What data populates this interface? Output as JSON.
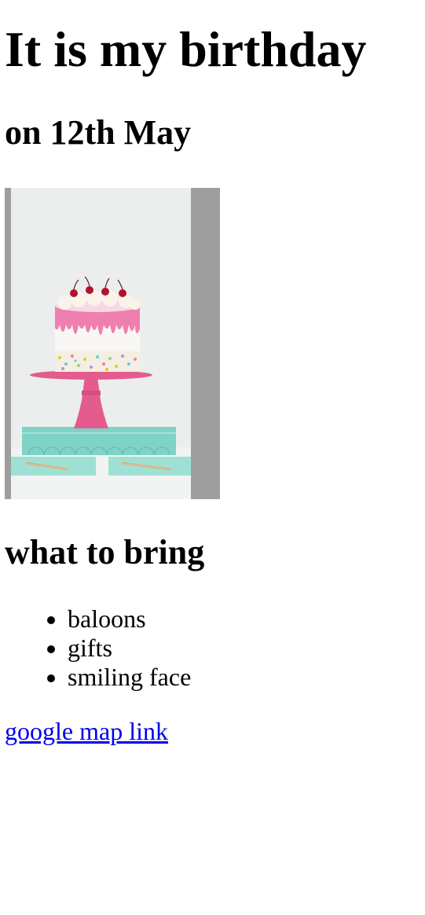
{
  "page": {
    "title": "It is my birthday",
    "subtitle": "on 12th May",
    "section_heading": "what to bring",
    "bring_items": [
      "baloons",
      "gifts",
      "smiling face"
    ],
    "map_link_text": "google map link"
  },
  "image": {
    "alt": "birthday cake on a pink cake stand",
    "colors": {
      "background_gray": "#9e9e9e",
      "wall": "#eceeee",
      "frosting": "#f8d8e4",
      "drip": "#ef7fae",
      "stand": "#e35c8d",
      "tray": "#7fd3c6",
      "cherry": "#b3122d"
    }
  },
  "theme": {
    "link_color": "#0000ee",
    "text_color": "#000000"
  }
}
